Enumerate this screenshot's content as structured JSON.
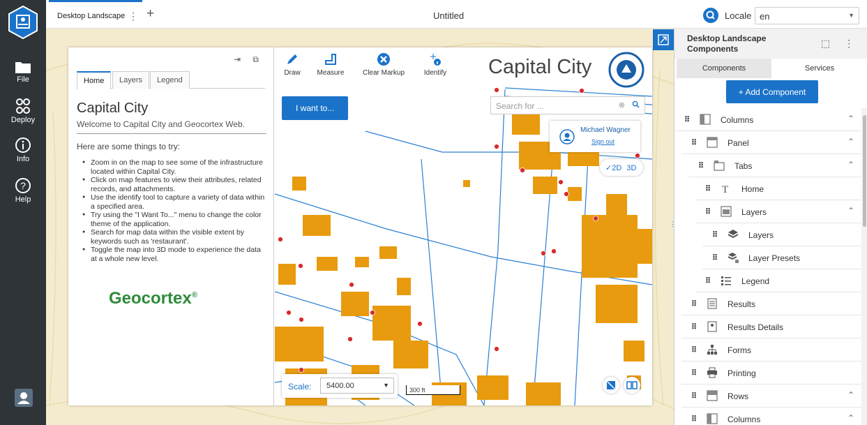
{
  "rail": {
    "items": [
      {
        "label": "File",
        "icon": "folder-icon"
      },
      {
        "label": "Deploy",
        "icon": "deploy-icon"
      },
      {
        "label": "Info",
        "icon": "info-icon"
      },
      {
        "label": "Help",
        "icon": "help-icon"
      }
    ]
  },
  "topbar": {
    "doc_tab": "Desktop Landscape",
    "add_tab": "+",
    "title": "Untitled",
    "locale_label": "Locale",
    "locale_value": "en"
  },
  "left_panel": {
    "tabs": [
      "Home",
      "Layers",
      "Legend"
    ],
    "title": "Capital City",
    "subtitle": "Welcome to Capital City and Geocortex Web.",
    "intro": "Here are some things to try:",
    "tips": [
      "Zoom in on the map to see some of the infrastructure located within Capital City.",
      "Click on map features to view their attributes, related records, and attachments.",
      "Use the identify tool to capture a variety of data within a specified area.",
      "Try using the \"I Want To...\" menu to change the color theme of the application.",
      "Search for map data within the visible extent by keywords such as 'restaurant'.",
      "Toggle the map into 3D mode to experience the data at a whole new level."
    ],
    "logo_text": "Geocortex",
    "logo_mark": "®"
  },
  "map": {
    "tools": [
      {
        "label": "Draw"
      },
      {
        "label": "Measure"
      },
      {
        "label": "Clear Markup"
      },
      {
        "label": "Identify"
      }
    ],
    "city_title": "Capital City",
    "want_button": "I want to...",
    "search_placeholder": "Search for ...",
    "user_name": "Michael Wagner",
    "sign_out": "Sign out",
    "mode_2d": "✓2D",
    "mode_3d": "3D",
    "scale_label": "Scale:",
    "scale_value": "5400.00",
    "scalebar_label": "300 ft"
  },
  "right_panel": {
    "title": "Desktop Landscape Components",
    "tabs": [
      "Components",
      "Services"
    ],
    "add_button": "+ Add Component",
    "components": [
      {
        "label": "Columns",
        "indent": 0,
        "icon": "columns-icon",
        "expanded": true
      },
      {
        "label": "Panel",
        "indent": 1,
        "icon": "panel-icon",
        "expanded": true
      },
      {
        "label": "Tabs",
        "indent": 2,
        "icon": "tabs-icon",
        "expanded": true
      },
      {
        "label": "Home",
        "indent": 3,
        "icon": "text-icon",
        "expanded": false
      },
      {
        "label": "Layers",
        "indent": 3,
        "icon": "layers-panel-icon",
        "expanded": true
      },
      {
        "label": "Layers",
        "indent": 4,
        "icon": "layers-icon",
        "expanded": false
      },
      {
        "label": "Layer Presets",
        "indent": 4,
        "icon": "layer-presets-icon",
        "expanded": false
      },
      {
        "label": "Legend",
        "indent": 3,
        "icon": "legend-icon",
        "expanded": false
      },
      {
        "label": "Results",
        "indent": 1,
        "icon": "results-icon",
        "expanded": false
      },
      {
        "label": "Results Details",
        "indent": 1,
        "icon": "results-details-icon",
        "expanded": false
      },
      {
        "label": "Forms",
        "indent": 1,
        "icon": "forms-icon",
        "expanded": false
      },
      {
        "label": "Printing",
        "indent": 1,
        "icon": "printing-icon",
        "expanded": false
      },
      {
        "label": "Rows",
        "indent": 1,
        "icon": "rows-icon",
        "expanded": true
      },
      {
        "label": "Columns",
        "indent": 1,
        "icon": "columns-icon",
        "expanded": true
      }
    ]
  },
  "colors": {
    "accent": "#1a73c9",
    "rail": "#2f3438",
    "building": "#e89b0e",
    "map_bg": "#f4ebce",
    "brand_green": "#2e8b3a"
  }
}
